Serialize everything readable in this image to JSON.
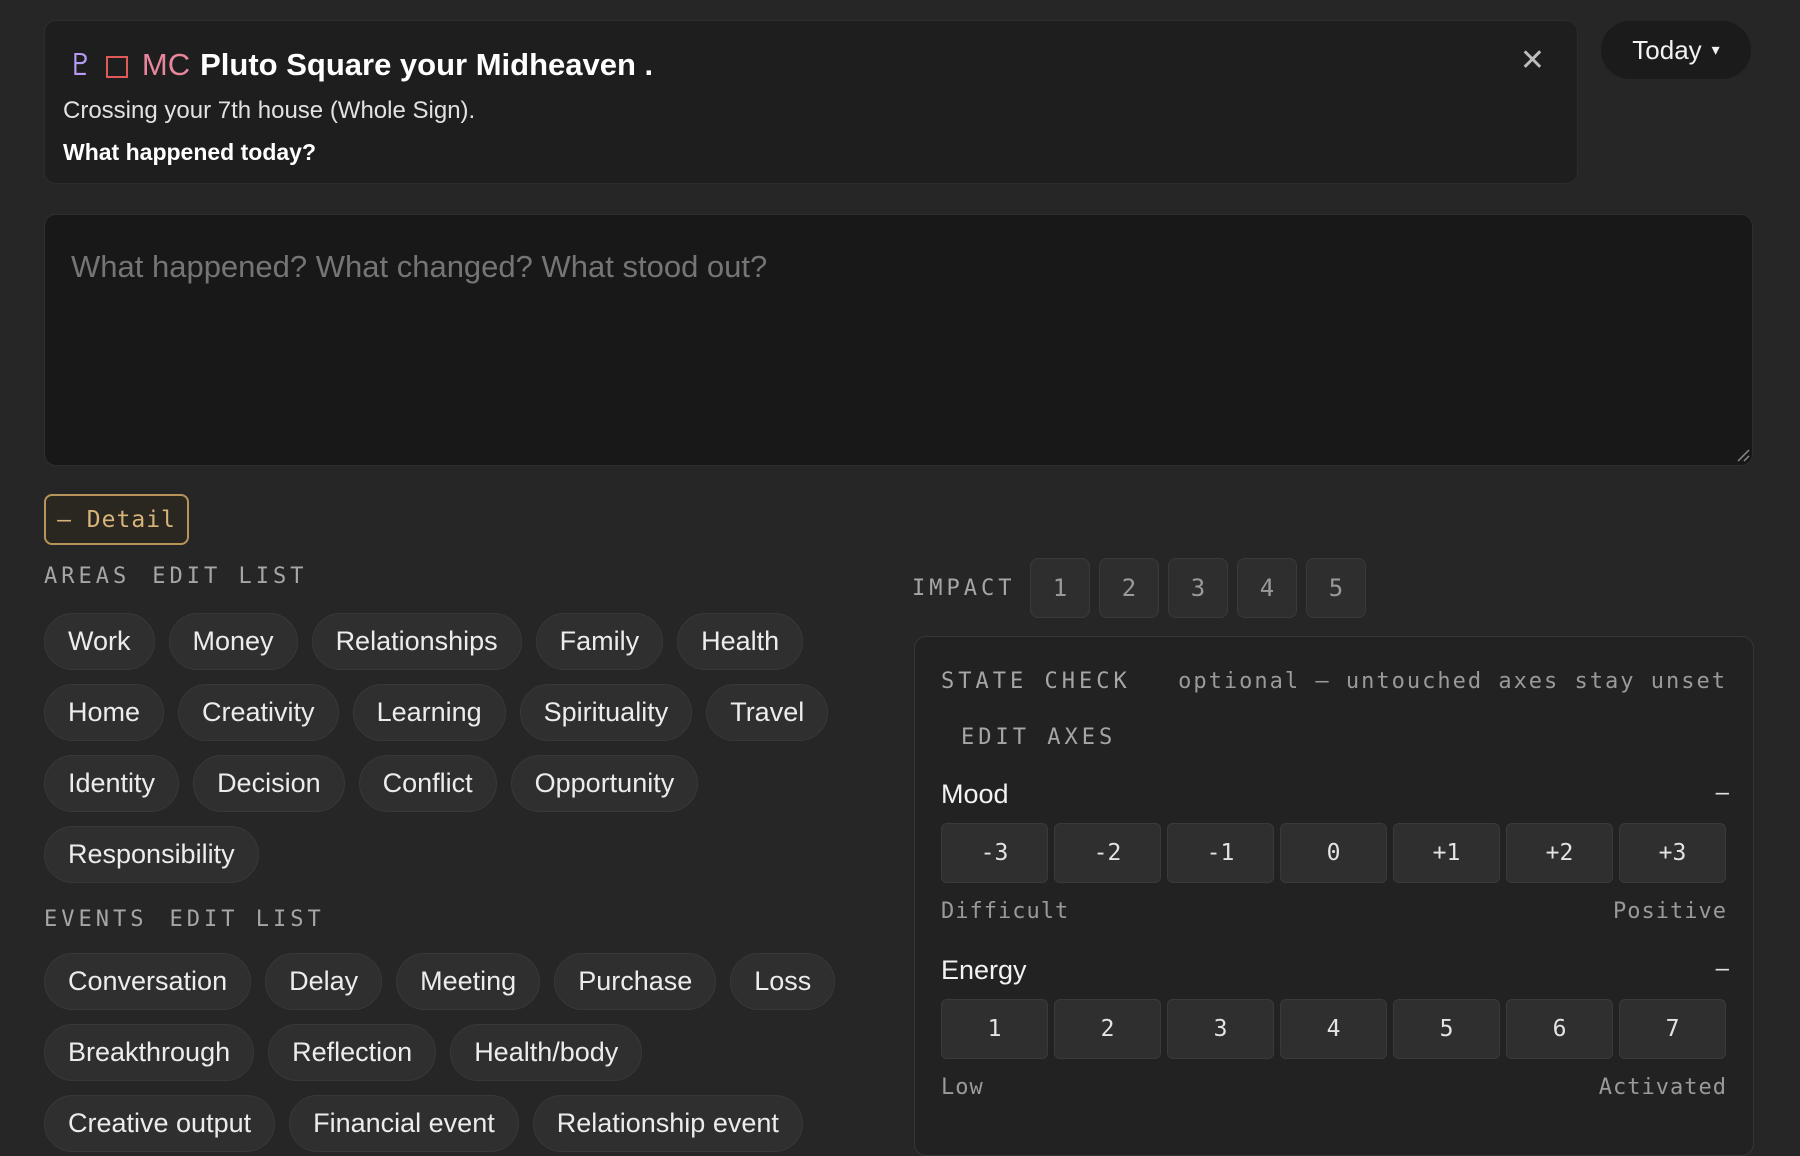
{
  "transit": {
    "planet_glyph": "♇",
    "aspect_glyph": "square",
    "point_label": "MC",
    "title": "Pluto Square your Midheaven .",
    "subtitle": "Crossing your 7th house (Whole Sign).",
    "question": "What happened today?",
    "close_glyph": "✕"
  },
  "date_picker": {
    "label": "Today",
    "caret": "▾"
  },
  "notes": {
    "placeholder": "What happened? What changed? What stood out?"
  },
  "detail_toggle": {
    "label": "– Detail"
  },
  "areas": {
    "label": "AREAS",
    "edit_label": "EDIT LIST",
    "items": [
      "Work",
      "Money",
      "Relationships",
      "Family",
      "Health",
      "Home",
      "Creativity",
      "Learning",
      "Spirituality",
      "Travel",
      "Identity",
      "Decision",
      "Conflict",
      "Opportunity",
      "Responsibility"
    ]
  },
  "events": {
    "label": "EVENTS",
    "edit_label": "EDIT LIST",
    "items": [
      "Conversation",
      "Delay",
      "Meeting",
      "Purchase",
      "Loss",
      "Breakthrough",
      "Reflection",
      "Health/body",
      "Creative output",
      "Financial event",
      "Relationship event"
    ]
  },
  "impact": {
    "label": "IMPACT",
    "options": [
      "1",
      "2",
      "3",
      "4",
      "5"
    ]
  },
  "state_check": {
    "title": "STATE CHECK",
    "note": "optional — untouched axes stay unset",
    "edit_label": "EDIT AXES",
    "axes": [
      {
        "name": "Mood",
        "collapse": "–",
        "options": [
          "-3",
          "-2",
          "-1",
          "0",
          "+1",
          "+2",
          "+3"
        ],
        "low": "Difficult",
        "high": "Positive"
      },
      {
        "name": "Energy",
        "collapse": "–",
        "options": [
          "1",
          "2",
          "3",
          "4",
          "5",
          "6",
          "7"
        ],
        "low": "Low",
        "high": "Activated"
      }
    ]
  },
  "colors": {
    "background": "#262626",
    "card": "#1e1e1e",
    "pluto_glyph": "#b69cf5",
    "square_glyph": "#e05a5a",
    "mc_label": "#e8869c",
    "detail_accent": "#d8b47a"
  }
}
